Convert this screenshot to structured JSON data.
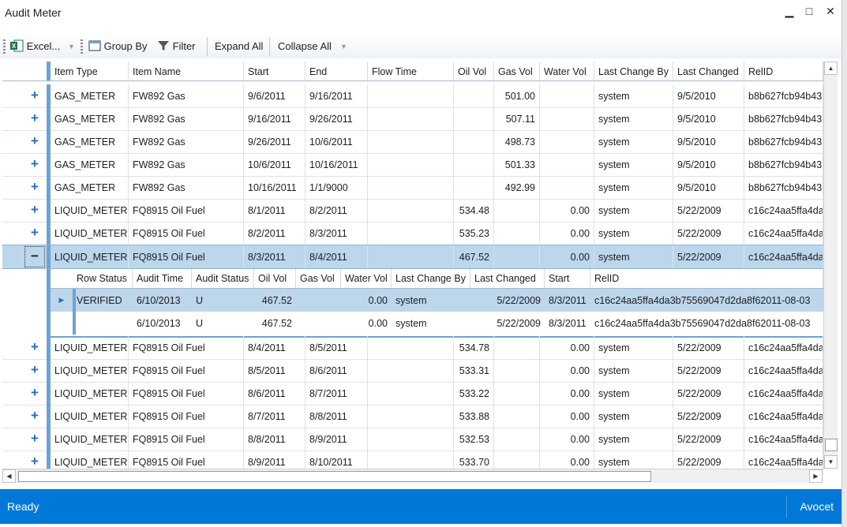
{
  "window": {
    "title": "Audit Meter",
    "min": "▁",
    "max": "□",
    "close": "✕"
  },
  "toolbar": {
    "excel": "Excel...",
    "group_by": "Group By",
    "filter": "Filter",
    "expand_all": "Expand All",
    "collapse_all": "Collapse All"
  },
  "grid": {
    "columns": [
      "Item Type",
      "Item Name",
      "Start",
      "End",
      "Flow Time",
      "Oil Vol",
      "Gas Vol",
      "Water Vol",
      "Last Change By",
      "Last Changed",
      "RelID"
    ],
    "rows_top": [
      [
        "GAS_METER",
        "FW892 Gas",
        "9/6/2011",
        "9/16/2011",
        "",
        "",
        "501.00",
        "",
        "system",
        "9/5/2010",
        "b8b627fcb94b43"
      ],
      [
        "GAS_METER",
        "FW892 Gas",
        "9/16/2011",
        "9/26/2011",
        "",
        "",
        "507.11",
        "",
        "system",
        "9/5/2010",
        "b8b627fcb94b43"
      ],
      [
        "GAS_METER",
        "FW892 Gas",
        "9/26/2011",
        "10/6/2011",
        "",
        "",
        "498.73",
        "",
        "system",
        "9/5/2010",
        "b8b627fcb94b43"
      ],
      [
        "GAS_METER",
        "FW892 Gas",
        "10/6/2011",
        "10/16/2011",
        "",
        "",
        "501.33",
        "",
        "system",
        "9/5/2010",
        "b8b627fcb94b43"
      ],
      [
        "GAS_METER",
        "FW892 Gas",
        "10/16/2011",
        "1/1/9000",
        "",
        "",
        "492.99",
        "",
        "system",
        "9/5/2010",
        "b8b627fcb94b43"
      ],
      [
        "LIQUID_METER",
        "FQ8915 Oil Fuel",
        "8/1/2011",
        "8/2/2011",
        "",
        "534.48",
        "",
        "0.00",
        "system",
        "5/22/2009",
        "c16c24aa5ffa4da"
      ],
      [
        "LIQUID_METER",
        "FQ8915 Oil Fuel",
        "8/2/2011",
        "8/3/2011",
        "",
        "535.23",
        "",
        "0.00",
        "system",
        "5/22/2009",
        "c16c24aa5ffa4da"
      ],
      [
        "LIQUID_METER",
        "FQ8915 Oil Fuel",
        "8/3/2011",
        "8/4/2011",
        "",
        "467.52",
        "",
        "0.00",
        "system",
        "5/22/2009",
        "c16c24aa5ffa4da"
      ]
    ],
    "rows_bottom": [
      [
        "LIQUID_METER",
        "FQ8915 Oil Fuel",
        "8/4/2011",
        "8/5/2011",
        "",
        "534.78",
        "",
        "0.00",
        "system",
        "5/22/2009",
        "c16c24aa5ffa4da"
      ],
      [
        "LIQUID_METER",
        "FQ8915 Oil Fuel",
        "8/5/2011",
        "8/6/2011",
        "",
        "533.31",
        "",
        "0.00",
        "system",
        "5/22/2009",
        "c16c24aa5ffa4da"
      ],
      [
        "LIQUID_METER",
        "FQ8915 Oil Fuel",
        "8/6/2011",
        "8/7/2011",
        "",
        "533.22",
        "",
        "0.00",
        "system",
        "5/22/2009",
        "c16c24aa5ffa4da"
      ],
      [
        "LIQUID_METER",
        "FQ8915 Oil Fuel",
        "8/7/2011",
        "8/8/2011",
        "",
        "533.88",
        "",
        "0.00",
        "system",
        "5/22/2009",
        "c16c24aa5ffa4da"
      ],
      [
        "LIQUID_METER",
        "FQ8915 Oil Fuel",
        "8/8/2011",
        "8/9/2011",
        "",
        "532.53",
        "",
        "0.00",
        "system",
        "5/22/2009",
        "c16c24aa5ffa4da"
      ],
      [
        "LIQUID_METER",
        "FQ8915 Oil Fuel",
        "8/9/2011",
        "8/10/2011",
        "",
        "533.70",
        "",
        "0.00",
        "system",
        "5/22/2009",
        "c16c24aa5ffa4da"
      ]
    ],
    "detail": {
      "columns": [
        "Row Status",
        "Audit Time",
        "Audit Status",
        "Oil Vol",
        "Gas Vol",
        "Water Vol",
        "Last Change By",
        "Last Changed",
        "Start",
        "RelID"
      ],
      "rows": [
        [
          "VERIFIED",
          "6/10/2013",
          "U",
          "467.52",
          "",
          "0.00",
          "system",
          "5/22/2009",
          "8/3/2011",
          "c16c24aa5ffa4da3b75569047d2da8f62011-08-03"
        ],
        [
          "",
          "6/10/2013",
          "U",
          "467.52",
          "",
          "0.00",
          "system",
          "5/22/2009",
          "8/3/2011",
          "c16c24aa5ffa4da3b75569047d2da8f62011-08-03"
        ]
      ]
    }
  },
  "statusbar": {
    "left": "Ready",
    "right": "Avocet"
  },
  "colors": {
    "accent": "#0078d7",
    "selection": "#bcd6ec",
    "expander": "#2a6ebb"
  }
}
